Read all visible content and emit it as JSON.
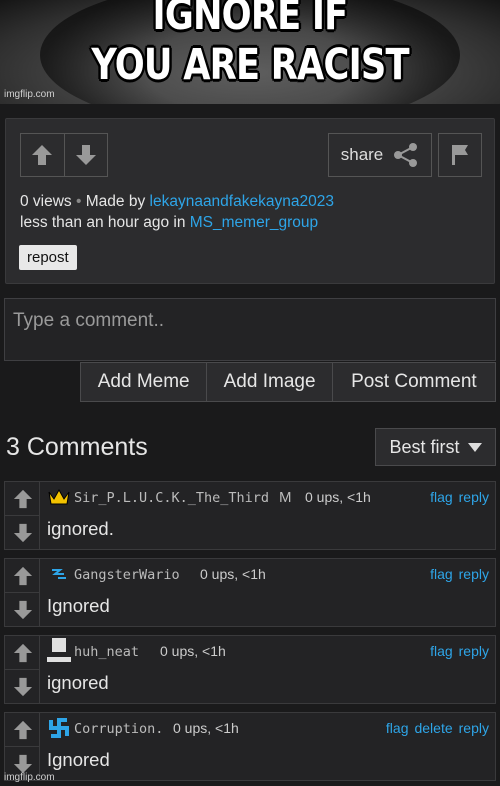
{
  "meme": {
    "caption_line1": "IGNORE IF",
    "caption_line2": "YOU ARE RACIST",
    "watermark": "imgflip.com"
  },
  "post": {
    "share_label": "share",
    "views": "0 views",
    "separator": "•",
    "made_by_prefix": "Made by",
    "author": "lekaynaandfakekayna2023",
    "time_prefix": "less than an hour ago in",
    "stream": "MS_memer_group",
    "repost_label": "repost"
  },
  "comment_form": {
    "placeholder": "Type a comment..",
    "add_meme_label": "Add Meme",
    "add_image_label": "Add Image",
    "post_label": "Post Comment"
  },
  "comments_header": {
    "count_label": "3 Comments",
    "sort_label": "Best first"
  },
  "comments": [
    {
      "username": "Sir_P.L.U.C.K._The_Third",
      "badge": "M",
      "ups": "0 ups, <1h",
      "flag": "flag",
      "delete": "",
      "reply": "reply",
      "text": "ignored.",
      "icon": "crown-icon"
    },
    {
      "username": "GangsterWario",
      "badge": "",
      "ups": "0 ups, <1h",
      "flag": "flag",
      "delete": "",
      "reply": "reply",
      "text": "Ignored",
      "icon": "squiggle-icon"
    },
    {
      "username": "huh_neat",
      "badge": "",
      "ups": "0 ups, <1h",
      "flag": "flag",
      "delete": "",
      "reply": "reply",
      "text": "ignored",
      "icon": "pixel-figure-icon"
    },
    {
      "username": "Corruption.",
      "badge": "",
      "ups": "0 ups, <1h",
      "flag": "flag",
      "delete": "delete",
      "reply": "reply",
      "text": "Ignored",
      "icon": "swastika-icon"
    }
  ],
  "footer_watermark": "imgflip.com",
  "colors": {
    "link": "#2ea5e8",
    "background": "#1a1a1b",
    "panel": "#2c2c2e"
  }
}
